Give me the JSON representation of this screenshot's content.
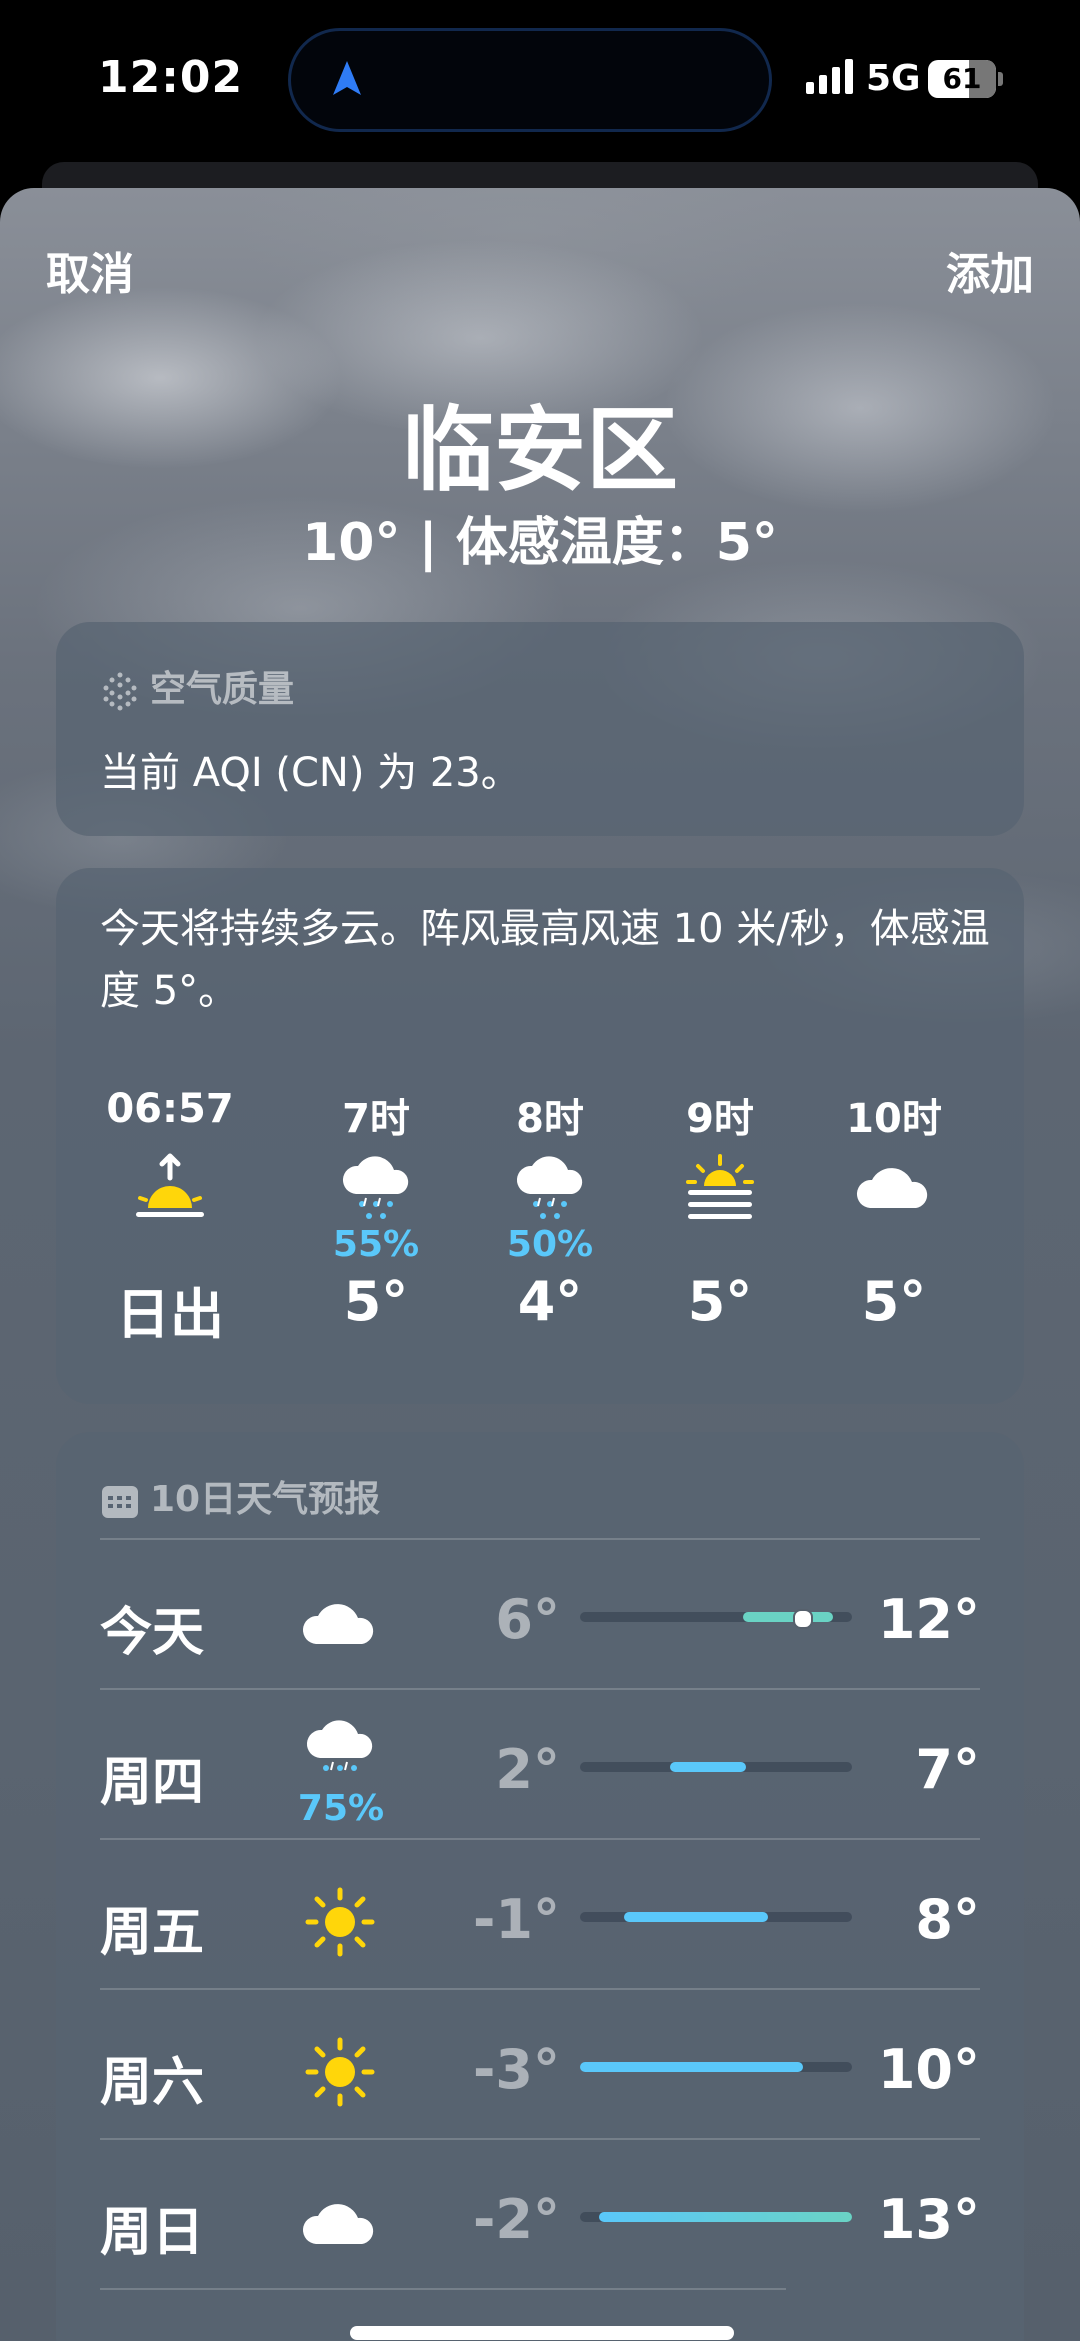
{
  "status": {
    "time": "12:02",
    "network": "5G",
    "battery": "61",
    "battery_level": 0.61
  },
  "sheet": {
    "cancel_label": "取消",
    "add_label": "添加"
  },
  "location": {
    "city": "临安区",
    "current_line": "10° | 体感温度：5°"
  },
  "air_quality": {
    "header": "空气质量",
    "text": "当前 AQI (CN) 为 23。",
    "icon": "aqi-dots-icon"
  },
  "hourly": {
    "summary": "今天将持续多云。阵风最高风速 10 米/秒，体感温度 5°。",
    "items": [
      {
        "label": "06:57",
        "icon": "sunrise-icon",
        "precip": "",
        "temp": "日出"
      },
      {
        "label": "7时",
        "icon": "cloud-snow-icon",
        "precip": "55%",
        "temp": "5°"
      },
      {
        "label": "8时",
        "icon": "cloud-snow-icon",
        "precip": "50%",
        "temp": "4°"
      },
      {
        "label": "9时",
        "icon": "sun-haze-icon",
        "precip": "",
        "temp": "5°"
      },
      {
        "label": "10时",
        "icon": "cloud-icon",
        "precip": "",
        "temp": "5°"
      }
    ]
  },
  "daily": {
    "header": "10日天气预报",
    "icon": "calendar-icon",
    "rows": [
      {
        "day": "今天",
        "icon": "cloud-icon",
        "precip": "",
        "low": "6°",
        "high": "12°",
        "range_start": 0.6,
        "range_end": 0.93,
        "current": 0.82
      },
      {
        "day": "周四",
        "icon": "cloud-snow-icon",
        "precip": "75%",
        "low": "2°",
        "high": "7°",
        "range_start": 0.33,
        "range_end": 0.61
      },
      {
        "day": "周五",
        "icon": "sun-icon",
        "precip": "",
        "low": "-1°",
        "high": "8°",
        "range_start": 0.16,
        "range_end": 0.69
      },
      {
        "day": "周六",
        "icon": "sun-icon",
        "precip": "",
        "low": "-3°",
        "high": "10°",
        "range_start": 0.0,
        "range_end": 0.82
      },
      {
        "day": "周日",
        "icon": "cloud-icon",
        "precip": "",
        "low": "-2°",
        "high": "13°",
        "range_start": 0.07,
        "range_end": 1.0
      }
    ]
  },
  "colors": {
    "accent_blue": "#5ac8fa",
    "sun_yellow": "#ffd60a",
    "bar_teal": "#6ad3c4"
  }
}
